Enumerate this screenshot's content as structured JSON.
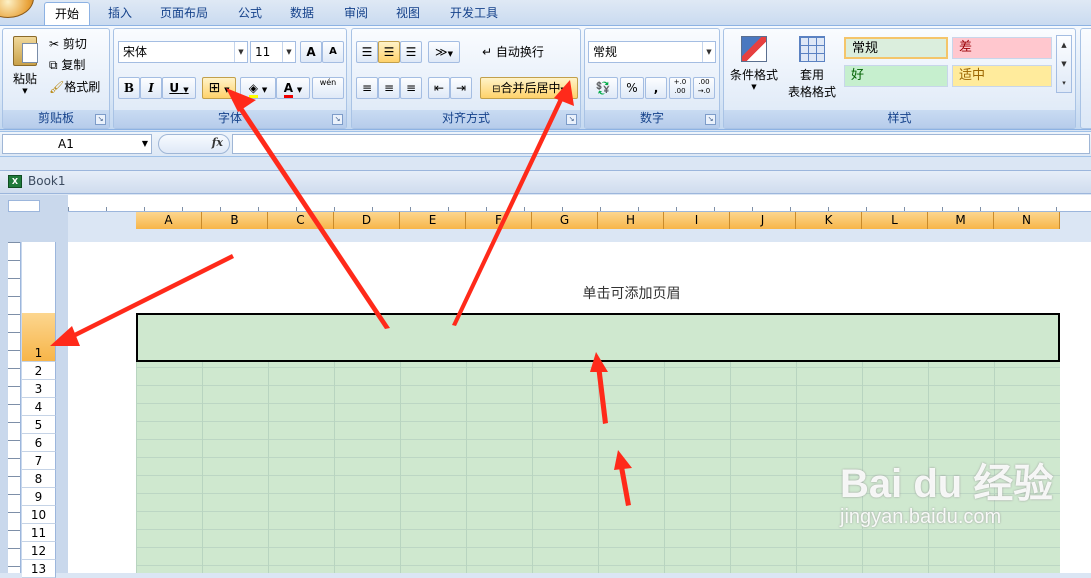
{
  "ribbon": {
    "tabs": [
      "开始",
      "插入",
      "页面布局",
      "公式",
      "数据",
      "审阅",
      "视图",
      "开发工具"
    ],
    "active_tab": "开始",
    "clipboard": {
      "paste": "粘贴",
      "cut": "剪切",
      "copy": "复制",
      "format_painter": "格式刷",
      "label": "剪贴板"
    },
    "font": {
      "name": "宋体",
      "size": "11",
      "bold": "B",
      "italic": "I",
      "underline": "U",
      "grow": "A",
      "shrink": "A",
      "font_color": "A",
      "phonetic": "wén",
      "label": "字体"
    },
    "alignment": {
      "wrap": "自动换行",
      "merge": "合并后居中",
      "label": "对齐方式"
    },
    "number": {
      "format": "常规",
      "percent": "%",
      "comma": ",",
      "inc": "+.0 .00",
      "dec": ".00 →.0",
      "label": "数字"
    },
    "styles": {
      "conditional": "条件格式",
      "table1": "套用",
      "table2": "表格格式",
      "normal": "常规",
      "bad": "差",
      "good": "好",
      "neutral": "适中",
      "label": "样式"
    }
  },
  "formula_bar": {
    "name_box": "A1",
    "fx": "fx"
  },
  "workbook": {
    "title": "Book1"
  },
  "sheet": {
    "header_hint": "单击可添加页眉",
    "columns": [
      "A",
      "B",
      "C",
      "D",
      "E",
      "F",
      "G",
      "H",
      "I",
      "J",
      "K",
      "L",
      "M",
      "N"
    ],
    "rows": [
      "1",
      "2",
      "3",
      "4",
      "5",
      "6",
      "7",
      "8",
      "9",
      "10",
      "11",
      "12",
      "13"
    ]
  },
  "watermark": {
    "brand": "Bai du 经验",
    "url": "jingyan.baidu.com"
  },
  "colors": {
    "accent": "#ff2a1a",
    "selection": "#f7b549",
    "fill": "#cfe8cf"
  }
}
